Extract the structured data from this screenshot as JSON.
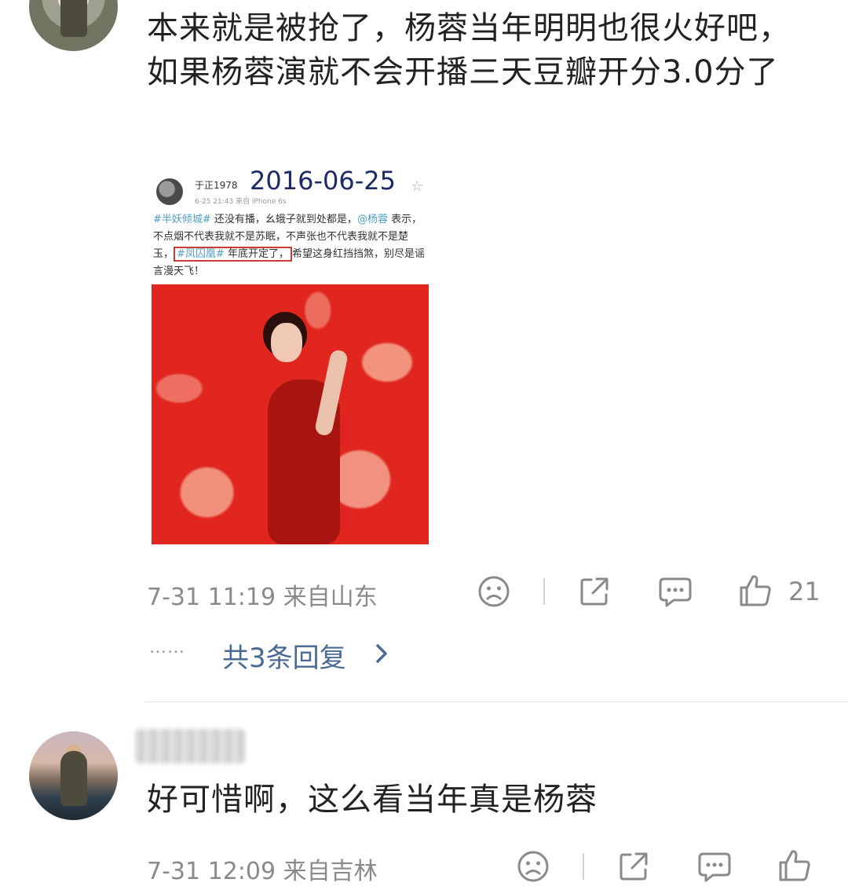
{
  "comments": [
    {
      "text": "本来就是被抢了，杨蓉当年明明也很火好吧，如果杨蓉演就不会开播三天豆瓣开分3.0分了",
      "time_location": "7-31 11:19  来自山东",
      "like_count": "21",
      "replies_label": "共3条回复",
      "replies_dots": "……",
      "image": {
        "author": "于正1978",
        "date_overlay": "2016-06-25",
        "sub": "6-25 21:43  来自 iPhone 6s",
        "star": "☆",
        "body": {
          "tag1": "#半妖倾城#",
          "part1": " 还没有播，幺蛾子就到处都是，",
          "mention": "@杨蓉",
          "part2": " 表示，不点烟不代表我就不是苏眠，不声张也不代表我就不是楚玉，",
          "tag2": "#凤囚凰#",
          "boxed_text": " 年底开定了，",
          "part3": "希望这身红挡挡煞，别尽是谣言漫天飞！"
        }
      }
    },
    {
      "text": "好可惜啊，这么看当年真是杨蓉",
      "time_location": "7-31 12:09  来自吉林"
    }
  ],
  "icons": [
    "sad-face-icon",
    "share-icon",
    "comment-icon",
    "thumbs-up-icon"
  ],
  "colors": {
    "link": "#4a6a96",
    "meta": "#8a8a8a",
    "highlight_box": "#c93b35",
    "photo_red": "#e0261e"
  }
}
